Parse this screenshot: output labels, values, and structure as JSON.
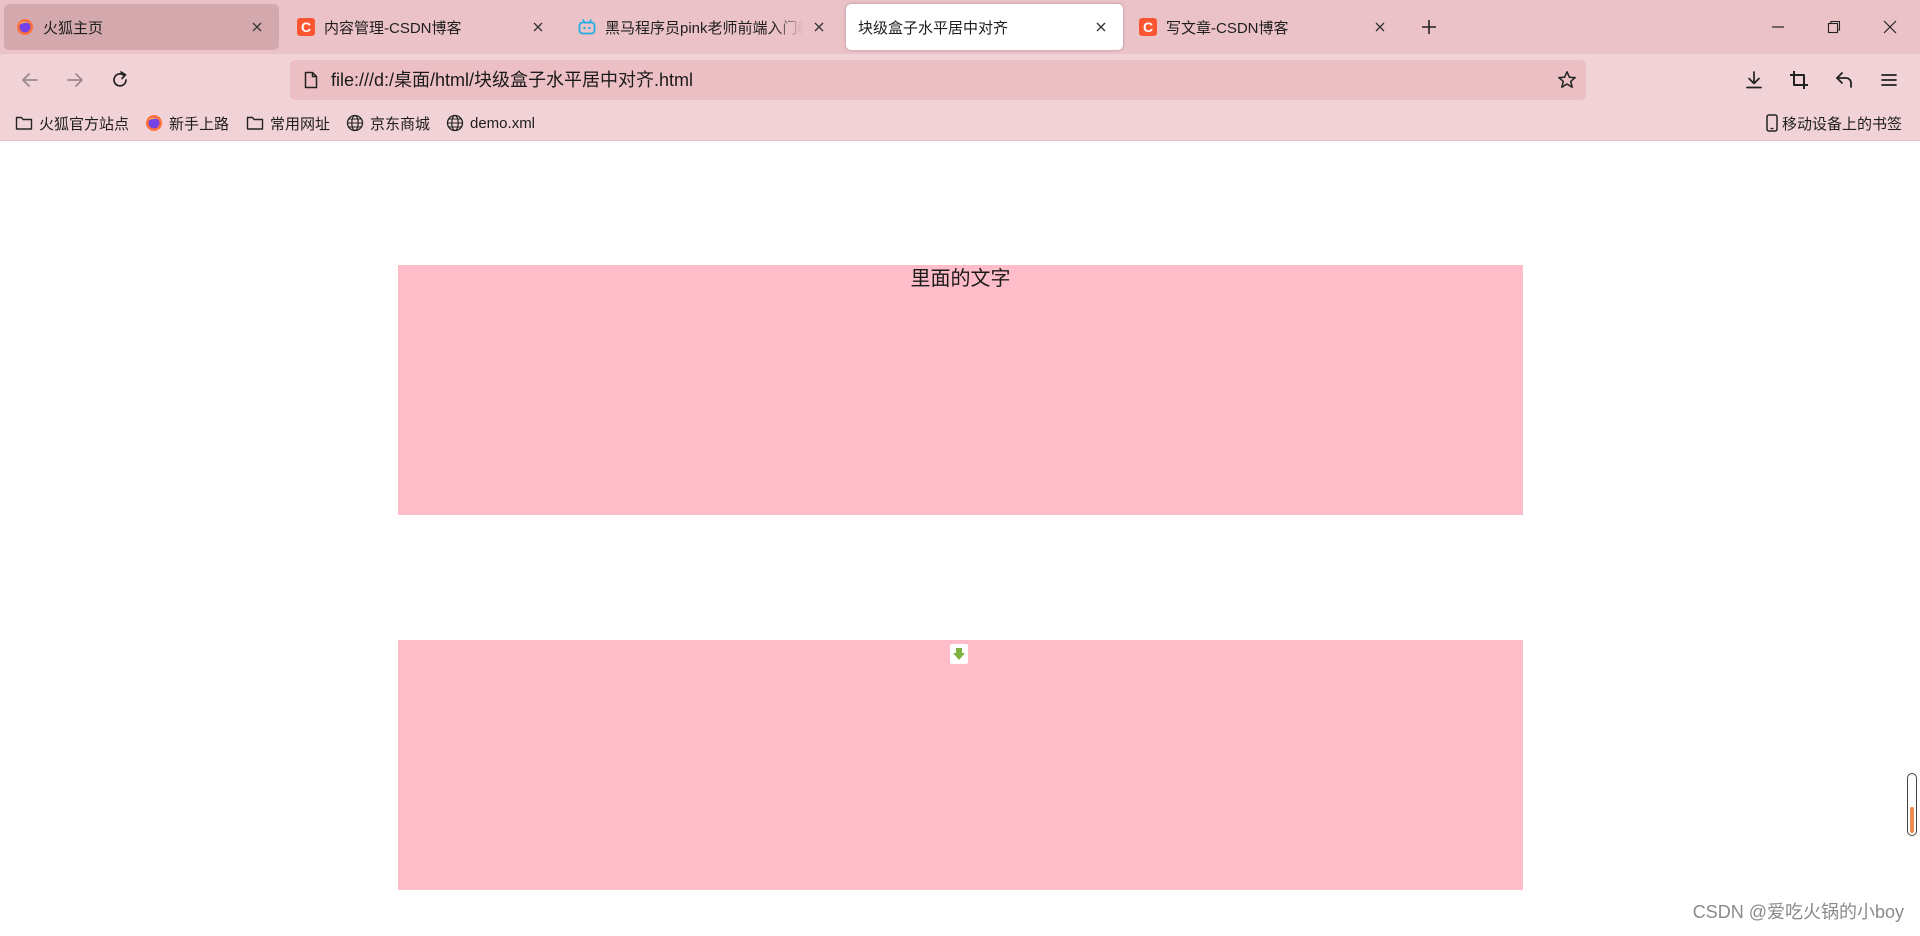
{
  "tabs": [
    {
      "title": "火狐主页",
      "icon": "firefox-icon",
      "state": "hover"
    },
    {
      "title": "内容管理-CSDN博客",
      "icon": "csdn-icon",
      "state": "normal"
    },
    {
      "title": "黑马程序员pink老师前端入门教",
      "icon": "bilibili-icon",
      "state": "normal"
    },
    {
      "title": "块级盒子水平居中对齐",
      "icon": "none",
      "state": "active"
    },
    {
      "title": "写文章-CSDN博客",
      "icon": "csdn-icon",
      "state": "normal"
    }
  ],
  "csdn_letter": "C",
  "window_controls": {
    "minimize": "minimize-icon",
    "restore": "restore-icon",
    "close": "close-icon"
  },
  "url": "file:///d:/桌面/html/块级盒子水平居中对齐.html",
  "bookmarks": [
    {
      "label": "火狐官方站点",
      "icon": "folder-icon"
    },
    {
      "label": "新手上路",
      "icon": "firefox-icon"
    },
    {
      "label": "常用网址",
      "icon": "folder-icon"
    },
    {
      "label": "京东商城",
      "icon": "globe-icon"
    },
    {
      "label": "demo.xml",
      "icon": "globe-icon"
    }
  ],
  "mobile_bookmarks": "移动设备上的书签",
  "content": {
    "box1_text": "里面的文字",
    "box_color": "#ffbdc9"
  },
  "watermark": "CSDN @爱吃火锅的小boy",
  "colors": {
    "tabbar": "#ebc2c8",
    "toolbar": "#f1d3d7",
    "urlbar": "#ecbfc5",
    "csdn": "#fc5531",
    "accent_orange": "#f08a4b"
  }
}
